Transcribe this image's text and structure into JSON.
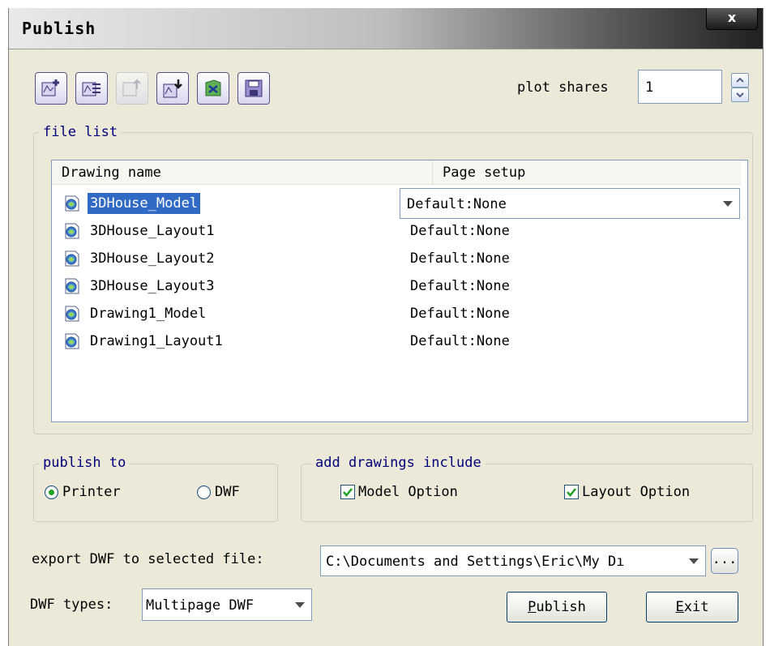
{
  "window": {
    "title": "Publish",
    "close_label": "x"
  },
  "toolbar": {
    "buttons": [
      {
        "name": "add-sheets-icon",
        "enabled": true
      },
      {
        "name": "remove-sheets-icon",
        "enabled": true
      },
      {
        "name": "move-sheet-up-icon",
        "enabled": false
      },
      {
        "name": "move-sheet-down-icon",
        "enabled": true
      },
      {
        "name": "load-sheet-list-icon",
        "enabled": true
      },
      {
        "name": "save-sheet-list-icon",
        "enabled": true
      }
    ]
  },
  "plot_shares": {
    "label": "plot shares",
    "value": "1"
  },
  "file_list": {
    "group_label": "file list",
    "columns": [
      "Drawing name",
      "Page setup"
    ],
    "rows": [
      {
        "name": "3DHouse_Model",
        "page_setup": "Default:None",
        "selected": true
      },
      {
        "name": "3DHouse_Layout1",
        "page_setup": "Default:None"
      },
      {
        "name": "3DHouse_Layout2",
        "page_setup": "Default:None"
      },
      {
        "name": "3DHouse_Layout3",
        "page_setup": "Default:None"
      },
      {
        "name": "Drawing1_Model",
        "page_setup": "Default:None"
      },
      {
        "name": "Drawing1_Layout1",
        "page_setup": "Default:None"
      }
    ]
  },
  "publish_to": {
    "group_label": "publish to",
    "options": [
      "Printer",
      "DWF"
    ],
    "selected": "Printer"
  },
  "add_drawings": {
    "group_label": "add drawings include",
    "model_label": "Model Option",
    "model_checked": true,
    "layout_label": "Layout Option",
    "layout_checked": true
  },
  "export": {
    "label": "export DWF to selected file:",
    "path": "C:\\Documents and Settings\\Eric\\My Dı",
    "browse_label": "..."
  },
  "dwf_types": {
    "label": "DWF types:",
    "value": "Multipage DWF"
  },
  "buttons": {
    "publish": {
      "underline": "P",
      "rest": "ublish"
    },
    "exit": {
      "underline": "E",
      "rest": "xit"
    }
  },
  "colors": {
    "selection": "#316ac5",
    "group_title": "#00007a",
    "check": "#21a121"
  }
}
